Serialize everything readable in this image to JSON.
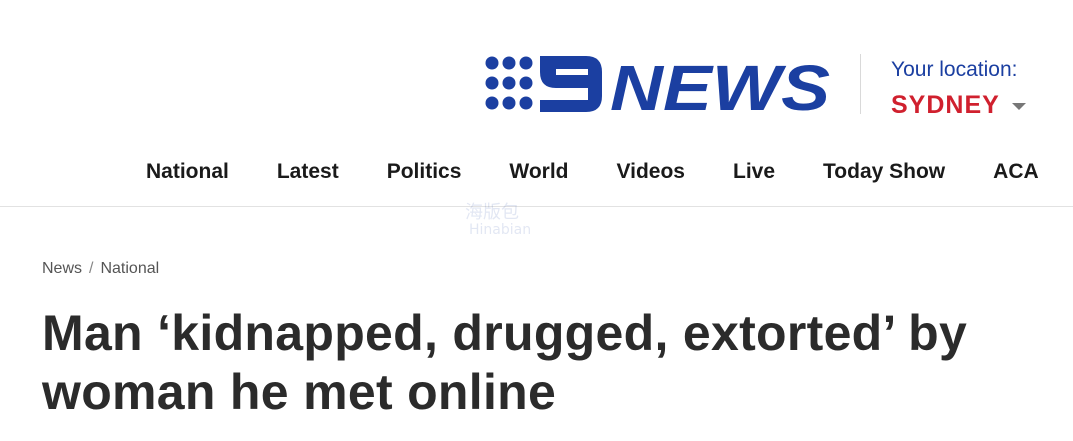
{
  "header": {
    "logo": {
      "name": "9NEWS",
      "numeral": "9",
      "wordmark": "NEWS",
      "color": "#1b3fa1"
    },
    "location": {
      "label": "Your location:",
      "city": "SYDNEY",
      "label_color": "#1b3fa1",
      "city_color": "#d0202e",
      "dropdown_icon": "caret-down-icon"
    }
  },
  "nav": {
    "items": [
      {
        "label": "National"
      },
      {
        "label": "Latest"
      },
      {
        "label": "Politics"
      },
      {
        "label": "World"
      },
      {
        "label": "Videos"
      },
      {
        "label": "Live"
      },
      {
        "label": "Today Show"
      },
      {
        "label": "ACA"
      }
    ]
  },
  "watermark": {
    "cn": "海版包",
    "en": "Hinabian"
  },
  "breadcrumb": {
    "items": [
      {
        "label": "News"
      },
      {
        "label": "National"
      }
    ],
    "separator": "/"
  },
  "article": {
    "headline": "Man ‘kidnapped, drugged, extorted’ by woman he met online"
  }
}
